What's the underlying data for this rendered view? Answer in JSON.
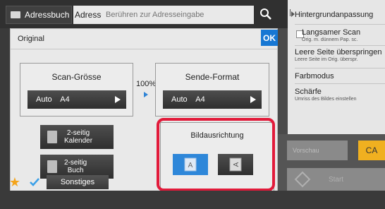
{
  "topbar": {
    "addressbook_label": "Adressbuch",
    "address_label": "Adresse",
    "address_placeholder": "Berühren zur Adresseingabe"
  },
  "dialog": {
    "title": "Original",
    "ok_label": "OK",
    "scan_size": {
      "title": "Scan-Grösse",
      "value": "Auto    A4"
    },
    "zoom": "100%",
    "send_format": {
      "title": "Sende-Format",
      "value": "Auto    A4"
    },
    "duplex_calendar": "2-seitig\nKalender",
    "duplex_calendar_lines": [
      "2-seitig",
      "Kalender"
    ],
    "duplex_book_lines": [
      "2-seitig",
      "Buch"
    ],
    "orientation": {
      "title": "Bildausrichtung",
      "portrait_glyph": "A",
      "landscape_glyph": "A"
    }
  },
  "bottombar": {
    "other_label": "Sonstiges"
  },
  "right_panel": {
    "items": [
      {
        "label": "Hintergrundanpassung",
        "sub": ""
      },
      {
        "label": "Langsamer Scan",
        "sub": "Orig. m. dünnem Pap. sc."
      },
      {
        "label": "Leere Seite überspringen",
        "sub": "Leere Seite im Orig. überspr."
      },
      {
        "label": "Farbmodus",
        "sub": ""
      },
      {
        "label": "Schärfe",
        "sub": "Umriss des Bildes einstellen"
      }
    ],
    "preview_label": "Vorschau",
    "ca_label": "CA",
    "start_label": "Start"
  },
  "colors": {
    "accent_blue": "#2e87d9",
    "highlight_red": "#e21a3a",
    "ca_orange": "#f0b020"
  }
}
